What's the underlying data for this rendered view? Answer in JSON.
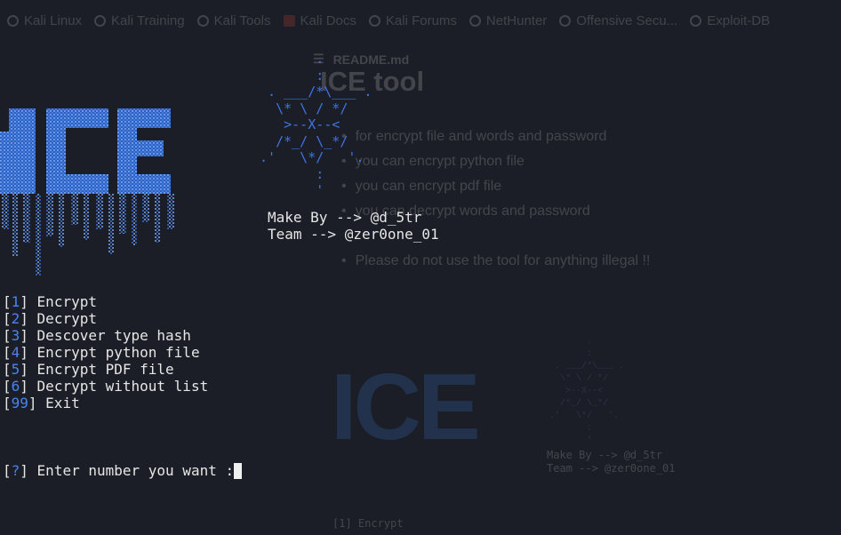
{
  "browser": {
    "bookmarks": [
      {
        "label": "Kali Linux",
        "icon": "kali-dragon-icon"
      },
      {
        "label": "Kali Training",
        "icon": "kali-dragon-icon"
      },
      {
        "label": "Kali Tools",
        "icon": "kali-dragon-icon"
      },
      {
        "label": "Kali Docs",
        "icon": "docs-icon"
      },
      {
        "label": "Kali Forums",
        "icon": "kali-dragon-icon"
      },
      {
        "label": "NetHunter",
        "icon": "kali-dragon-icon"
      },
      {
        "label": "Offensive Secu...",
        "icon": "offsec-icon"
      },
      {
        "label": "Exploit-DB",
        "icon": "exploit-db-icon"
      }
    ]
  },
  "readme": {
    "filename": "README.md",
    "title": "ICE tool",
    "bullets": [
      "for encrypt file and words and password",
      "you can encrypt python file",
      "you can encrypt pdf file",
      "you can decrypt words and password",
      "Please do not use the tool for anything illegal !!"
    ]
  },
  "terminal": {
    "logo_text": "ICE",
    "star_art": "        .\n        :\n  . ___/*\\___ .\n   \\* \\ / */\n    >--X--<\n   /*_/ \\_*/\n .'   \\*/   '.\n        :\n        '",
    "credits": {
      "make_by": "Make By --> @d_5tr",
      "team": "Team --> @zer0one_01"
    },
    "menu": [
      {
        "num": "1",
        "label": "Encrypt"
      },
      {
        "num": "2",
        "label": "Decrypt"
      },
      {
        "num": "3",
        "label": "Descover type hash"
      },
      {
        "num": "4",
        "label": "Encrypt python file"
      },
      {
        "num": "5",
        "label": "Encrypt PDF file"
      },
      {
        "num": "6",
        "label": "Decrypt without list"
      },
      {
        "num": "99",
        "label": "Exit"
      }
    ],
    "prompt": {
      "marker": "?",
      "text": "Enter number you want :"
    },
    "colors": {
      "background": "#1b1e26",
      "accent": "#3f73e3",
      "text": "#e6e6e6"
    }
  }
}
